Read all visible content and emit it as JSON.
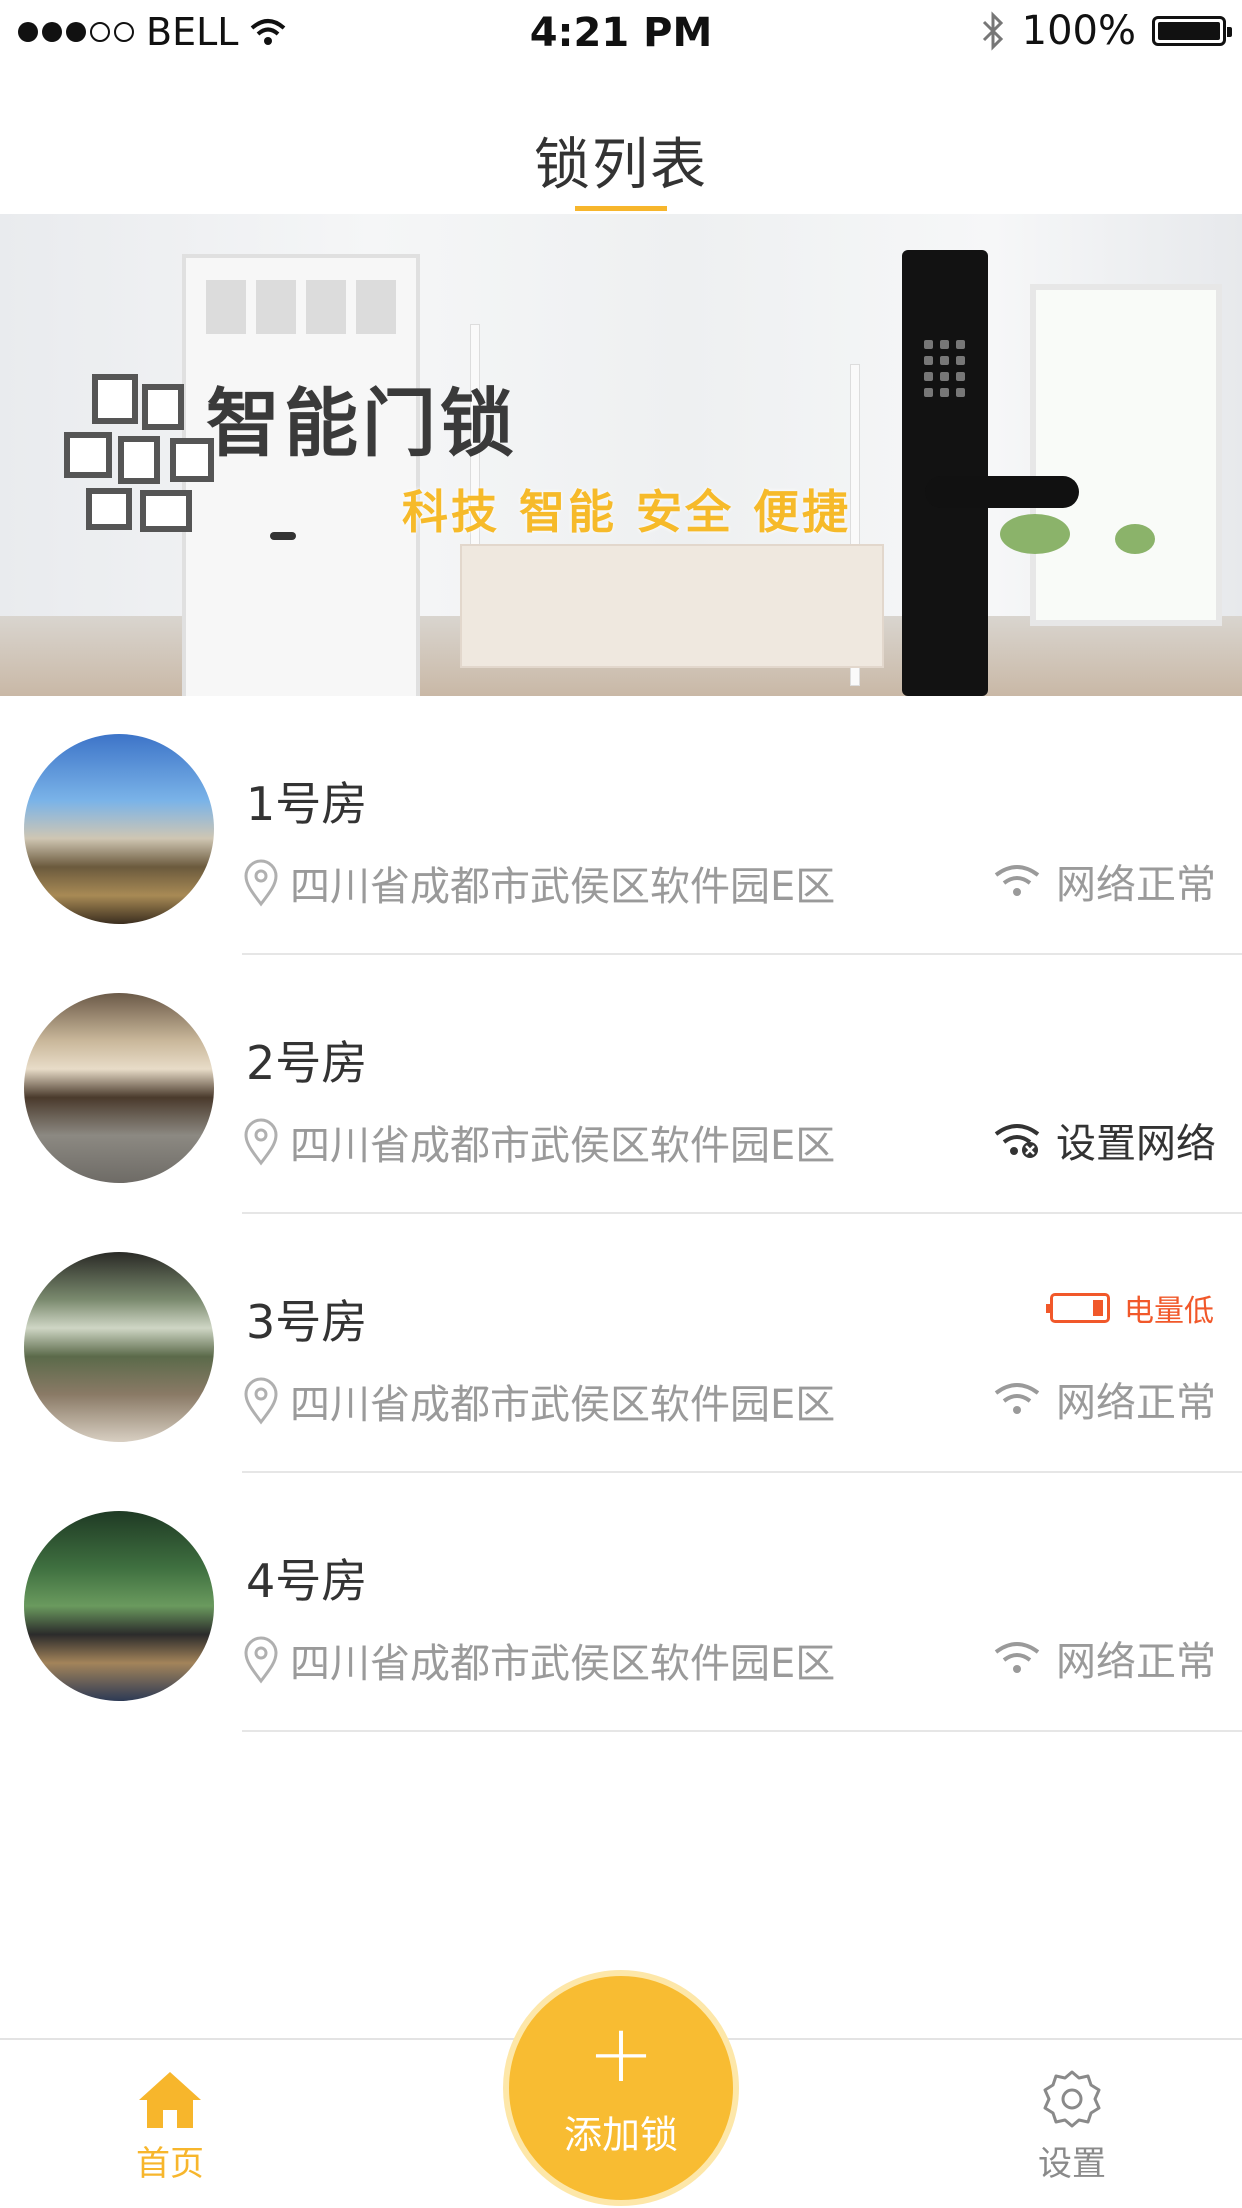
{
  "status_bar": {
    "carrier": "BELL",
    "time": "4:21 PM",
    "battery": "100%",
    "signal_icon": "signal-dots-icon",
    "wifi_icon": "wifi-icon",
    "bluetooth_icon": "bluetooth-icon"
  },
  "header": {
    "title": "锁列表"
  },
  "banner": {
    "headline": "智能门锁",
    "tagline": "科技 智能 安全 便捷"
  },
  "locks": [
    {
      "name": "1号房",
      "address": "四川省成都市武侯区软件园E区",
      "network": "网络正常",
      "network_state": "ok",
      "battery_low": false
    },
    {
      "name": "2号房",
      "address": "四川省成都市武侯区软件园E区",
      "network": "设置网络",
      "network_state": "setup",
      "battery_low": false
    },
    {
      "name": "3号房",
      "address": "四川省成都市武侯区软件园E区",
      "network": "网络正常",
      "network_state": "ok",
      "battery_low": true,
      "battery_text": "电量低"
    },
    {
      "name": "4号房",
      "address": "四川省成都市武侯区软件园E区",
      "network": "网络正常",
      "network_state": "ok",
      "battery_low": false
    }
  ],
  "tabbar": {
    "home": "首页",
    "add": "添加锁",
    "settings": "设置"
  },
  "colors": {
    "accent": "#f7b62c",
    "warning": "#f1582a",
    "muted": "#9a9a9a"
  }
}
